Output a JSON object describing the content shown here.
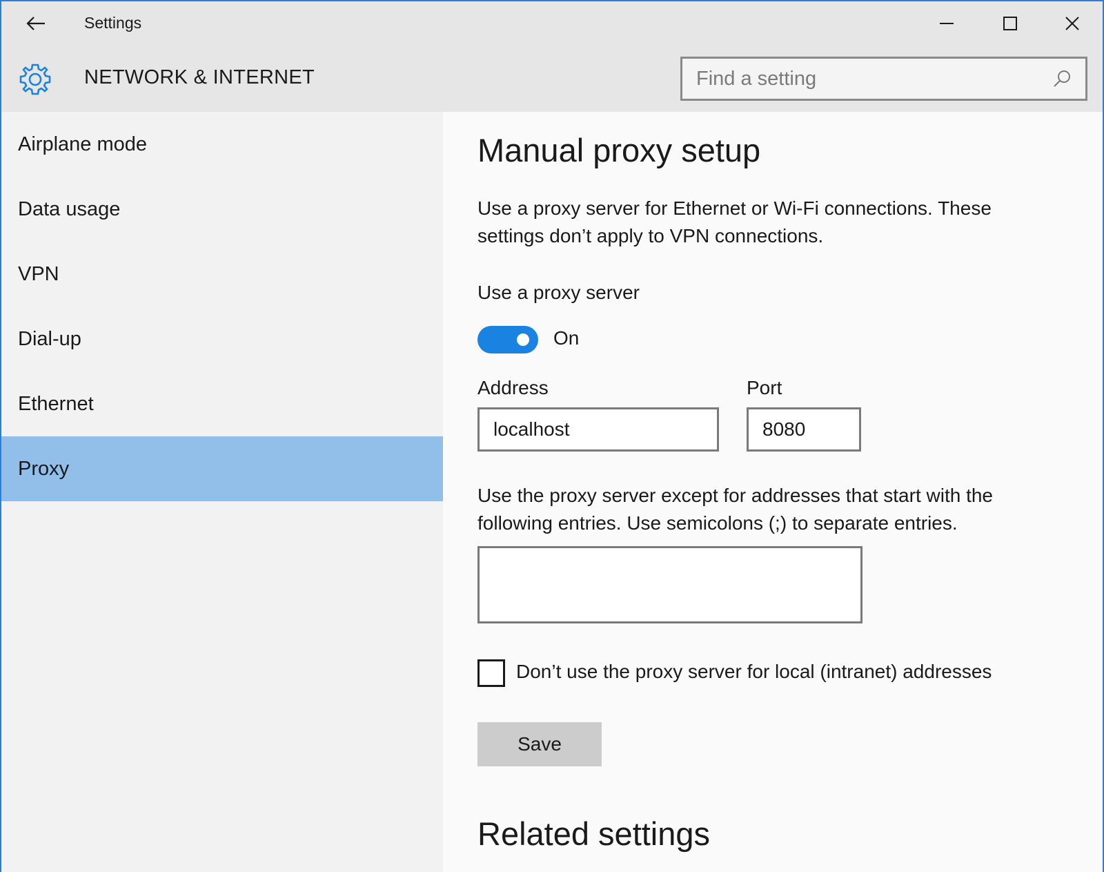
{
  "window": {
    "title": "Settings",
    "back_icon": "arrow-left-icon",
    "controls": [
      "minimize-icon",
      "maximize-icon",
      "close-icon"
    ]
  },
  "header": {
    "icon": "gear-icon",
    "title": "NETWORK & INTERNET",
    "search_placeholder": "Find a setting",
    "search_value": ""
  },
  "sidebar": {
    "items": [
      {
        "label": "Airplane mode"
      },
      {
        "label": "Data usage"
      },
      {
        "label": "VPN"
      },
      {
        "label": "Dial-up"
      },
      {
        "label": "Ethernet"
      },
      {
        "label": "Proxy"
      }
    ],
    "active": "Proxy"
  },
  "content": {
    "heading": "Manual proxy setup",
    "description": "Use a proxy server for Ethernet or Wi-Fi connections. These settings don’t apply to VPN connections.",
    "proxy_label": "Use a proxy server",
    "toggle_state": "On",
    "address_label": "Address",
    "address_value": "localhost",
    "port_label": "Port",
    "port_value": "8080",
    "exceptions_description": "Use the proxy server except for addresses that start with the following entries. Use semicolons (;) to separate entries.",
    "exceptions_value": "",
    "local_checkbox_label": "Don’t use the proxy server for local (intranet) addresses",
    "save_label": "Save",
    "related_heading": "Related settings"
  },
  "colors": {
    "accent": "#1a82e0",
    "active_nav": "#91bfe9",
    "window_border": "#2b7fd6"
  }
}
